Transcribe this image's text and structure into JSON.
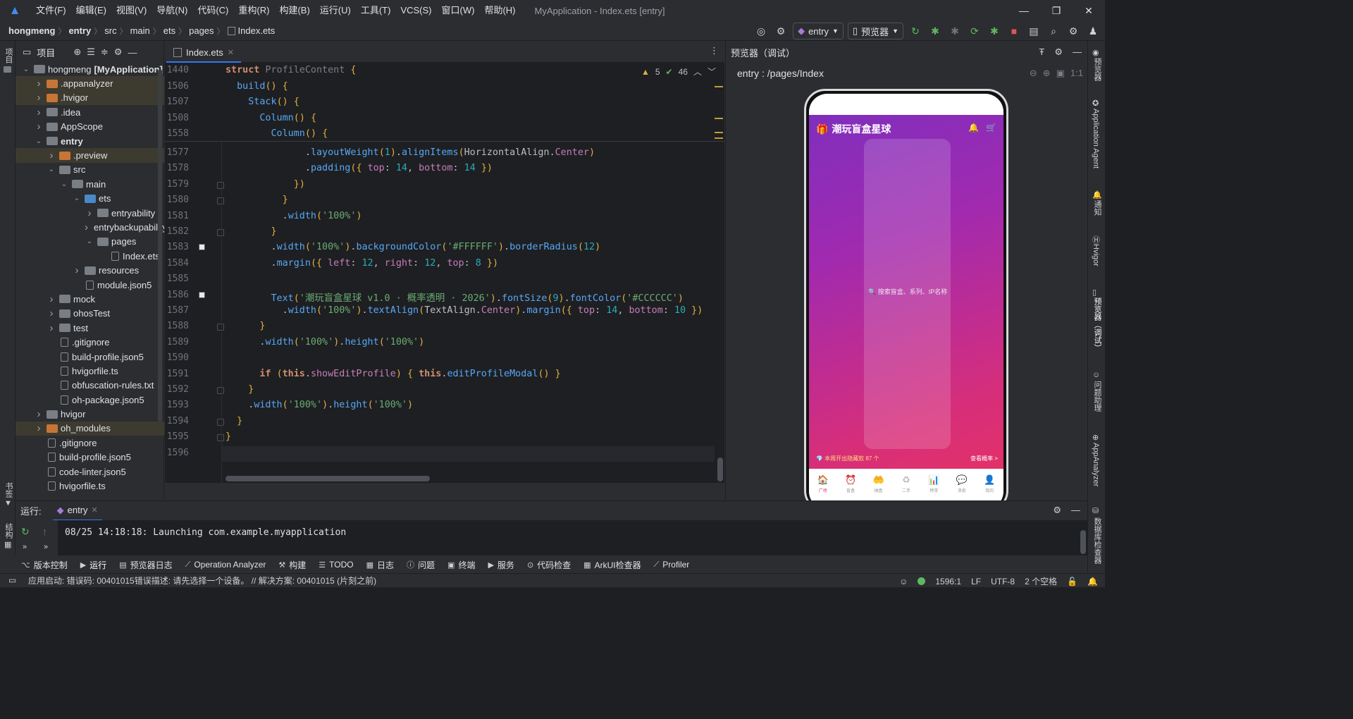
{
  "menus": [
    "文件(F)",
    "编辑(E)",
    "视图(V)",
    "导航(N)",
    "代码(C)",
    "重构(R)",
    "构建(B)",
    "运行(U)",
    "工具(T)",
    "VCS(S)",
    "窗口(W)",
    "帮助(H)"
  ],
  "window_title": "MyApplication - Index.ets [entry]",
  "breadcrumbs": [
    "hongmeng",
    "entry",
    "src",
    "main",
    "ets",
    "pages",
    "Index.ets"
  ],
  "nav": {
    "config": "entry",
    "device": "预览器"
  },
  "project": {
    "title": "项目",
    "tree": [
      {
        "name": "hongmeng",
        "bold_suffix": "[MyApplication]",
        "depth": 0,
        "arrow": "down",
        "icon": "folder"
      },
      {
        "name": ".appanalyzer",
        "depth": 1,
        "arrow": "right",
        "icon": "orange",
        "hl": true
      },
      {
        "name": ".hvigor",
        "depth": 1,
        "arrow": "right",
        "icon": "orange",
        "hl": true
      },
      {
        "name": ".idea",
        "depth": 1,
        "arrow": "right",
        "icon": "folder"
      },
      {
        "name": "AppScope",
        "depth": 1,
        "arrow": "right",
        "icon": "folder"
      },
      {
        "name": "entry",
        "depth": 1,
        "arrow": "down",
        "icon": "folder",
        "bold": true
      },
      {
        "name": ".preview",
        "depth": 2,
        "arrow": "right",
        "icon": "orange",
        "hl": true
      },
      {
        "name": "src",
        "depth": 2,
        "arrow": "down",
        "icon": "folder"
      },
      {
        "name": "main",
        "depth": 3,
        "arrow": "down",
        "icon": "folder"
      },
      {
        "name": "ets",
        "depth": 4,
        "arrow": "down",
        "icon": "blue"
      },
      {
        "name": "entryability",
        "depth": 5,
        "arrow": "right",
        "icon": "folder"
      },
      {
        "name": "entrybackupability",
        "depth": 5,
        "arrow": "right",
        "icon": "folder"
      },
      {
        "name": "pages",
        "depth": 5,
        "arrow": "down",
        "icon": "folder"
      },
      {
        "name": "Index.ets",
        "depth": 6,
        "arrow": "",
        "icon": "file"
      },
      {
        "name": "resources",
        "depth": 4,
        "arrow": "right",
        "icon": "folder"
      },
      {
        "name": "module.json5",
        "depth": 4,
        "arrow": "",
        "icon": "file"
      },
      {
        "name": "mock",
        "depth": 2,
        "arrow": "right",
        "icon": "folder"
      },
      {
        "name": "ohosTest",
        "depth": 2,
        "arrow": "right",
        "icon": "folder"
      },
      {
        "name": "test",
        "depth": 2,
        "arrow": "right",
        "icon": "folder"
      },
      {
        "name": ".gitignore",
        "depth": 2,
        "arrow": "",
        "icon": "file"
      },
      {
        "name": "build-profile.json5",
        "depth": 2,
        "arrow": "",
        "icon": "file"
      },
      {
        "name": "hvigorfile.ts",
        "depth": 2,
        "arrow": "",
        "icon": "file"
      },
      {
        "name": "obfuscation-rules.txt",
        "depth": 2,
        "arrow": "",
        "icon": "file"
      },
      {
        "name": "oh-package.json5",
        "depth": 2,
        "arrow": "",
        "icon": "file"
      },
      {
        "name": "hvigor",
        "depth": 1,
        "arrow": "right",
        "icon": "folder"
      },
      {
        "name": "oh_modules",
        "depth": 1,
        "arrow": "right",
        "icon": "orange",
        "hl": true
      },
      {
        "name": ".gitignore",
        "depth": 1,
        "arrow": "",
        "icon": "file"
      },
      {
        "name": "build-profile.json5",
        "depth": 1,
        "arrow": "",
        "icon": "file"
      },
      {
        "name": "code-linter.json5",
        "depth": 1,
        "arrow": "",
        "icon": "file"
      },
      {
        "name": "hvigorfile.ts",
        "depth": 1,
        "arrow": "",
        "icon": "file"
      }
    ]
  },
  "editor": {
    "tab": "Index.ets",
    "warnings": "5",
    "weak_warnings": "46",
    "sticky_lines": [
      {
        "n": "1440",
        "code": "struct ProfileContent {"
      },
      {
        "n": "1506",
        "code": "  build() {"
      },
      {
        "n": "1507",
        "code": "    Stack() {"
      },
      {
        "n": "1508",
        "code": "      Column() {"
      },
      {
        "n": "1558",
        "code": "        Column() {"
      }
    ],
    "lines": [
      {
        "n": "1577",
        "code": "              .layoutWeight(1).alignItems(HorizontalAlign.Center)"
      },
      {
        "n": "1578",
        "code": "              .padding({ top: 14, bottom: 14 })"
      },
      {
        "n": "1579",
        "code": "            })"
      },
      {
        "n": "1580",
        "code": "          }"
      },
      {
        "n": "1581",
        "code": "          .width('100%')"
      },
      {
        "n": "1582",
        "code": "        }"
      },
      {
        "n": "1583",
        "code": "        .width('100%').backgroundColor('#FFFFFF').borderRadius(12)"
      },
      {
        "n": "1584",
        "code": "        .margin({ left: 12, right: 12, top: 8 })"
      },
      {
        "n": "1585",
        "code": ""
      },
      {
        "n": "1586",
        "code": "        Text('潮玩盲盒星球 v1.0 · 概率透明 · 2026').fontSize(9).fontColor('#CCCCCC')"
      },
      {
        "n": "1587",
        "code": "          .width('100%').textAlign(TextAlign.Center).margin({ top: 14, bottom: 10 })"
      },
      {
        "n": "1588",
        "code": "      }"
      },
      {
        "n": "1589",
        "code": "      .width('100%').height('100%')"
      },
      {
        "n": "1590",
        "code": ""
      },
      {
        "n": "1591",
        "code": "      if (this.showEditProfile) { this.editProfileModal() }"
      },
      {
        "n": "1592",
        "code": "    }"
      },
      {
        "n": "1593",
        "code": "    .width('100%').height('100%')"
      },
      {
        "n": "1594",
        "code": "  }"
      },
      {
        "n": "1595",
        "code": "}"
      },
      {
        "n": "1596",
        "code": ""
      }
    ]
  },
  "preview": {
    "title": "预览器（调试）",
    "path": "entry : /pages/Index",
    "app_title": "潮玩盲盒星球",
    "search_placeholder": "🔍 搜索盲盒、系列、IP名称",
    "weekly": "💎 本周开出隐藏款 87 个",
    "weekly_link": "查看概率 >",
    "tabs": [
      "广场",
      "盲盒",
      "抽盒",
      "二手",
      "榜单",
      "消息",
      "我的"
    ]
  },
  "right_tools": [
    "预览器",
    "Application Agent",
    "通知",
    "Hvigor",
    "预览器（调试）",
    "问题助理",
    "AppAnalyzer",
    "数据库检查器"
  ],
  "left_tools": [
    "项目",
    "书签",
    "结构"
  ],
  "run": {
    "label": "运行:",
    "tab": "entry",
    "log": "08/25 14:18:18: Launching com.example.myapplication"
  },
  "tool_windows": [
    "版本控制",
    "运行",
    "预览器日志",
    "Operation Analyzer",
    "构建",
    "TODO",
    "日志",
    "问题",
    "终端",
    "服务",
    "代码检查",
    "ArkUI检查器",
    "Profiler"
  ],
  "status": {
    "message": "应用启动: 错误码: 00401015错误描述: 请先选择一个设备。 // 解决方案: 00401015 (片刻之前)",
    "position": "1596:1",
    "line_sep": "LF",
    "encoding": "UTF-8",
    "indent": "2 个空格"
  }
}
